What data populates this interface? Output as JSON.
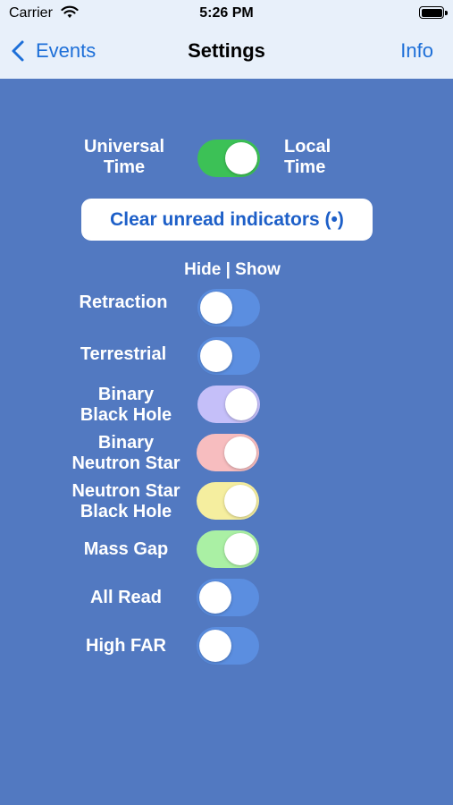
{
  "status": {
    "carrier": "Carrier",
    "time": "5:26 PM"
  },
  "nav": {
    "back_label": "Events",
    "title": "Settings",
    "info_label": "Info"
  },
  "time_toggle": {
    "left_label": [
      "Universal",
      "Time"
    ],
    "right_label": [
      "Local",
      "Time"
    ],
    "on": true,
    "color": "#3cc156"
  },
  "clear_button": {
    "label": "Clear unread indicators (•)"
  },
  "hide_show": "Hide | Show",
  "filters": [
    {
      "lines": [
        "Retraction"
      ],
      "on": false,
      "color": "#5b8ee0"
    },
    {
      "lines": [
        "Terrestrial"
      ],
      "on": false,
      "color": "#5b8ee0"
    },
    {
      "lines": [
        "Binary",
        "Black Hole"
      ],
      "on": true,
      "color": "#c5bff9"
    },
    {
      "lines": [
        "Binary",
        "Neutron Star"
      ],
      "on": true,
      "color": "#f7bdbf"
    },
    {
      "lines": [
        "Neutron Star",
        "Black Hole"
      ],
      "on": true,
      "color": "#f5ee9f"
    },
    {
      "lines": [
        "Mass Gap"
      ],
      "on": true,
      "color": "#aaf0a4"
    },
    {
      "lines": [
        "All Read"
      ],
      "on": false,
      "color": "#5b8ee0"
    },
    {
      "lines": [
        "High FAR"
      ],
      "on": false,
      "color": "#5b8ee0"
    }
  ]
}
